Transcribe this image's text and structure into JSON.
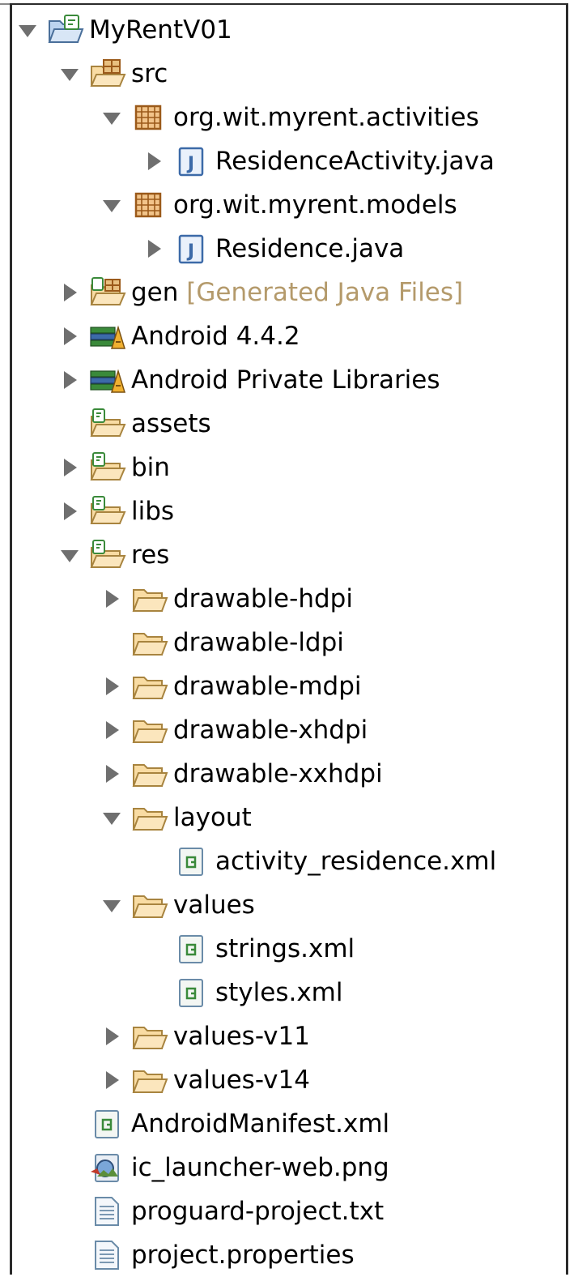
{
  "tree": [
    {
      "level": 0,
      "toggle": "open",
      "icon": "project-folder-icon",
      "label": "MyRentV01"
    },
    {
      "level": 1,
      "toggle": "open",
      "icon": "source-folder-icon",
      "label": "src"
    },
    {
      "level": 2,
      "toggle": "open",
      "icon": "package-icon",
      "label": "org.wit.myrent.activities"
    },
    {
      "level": 3,
      "toggle": "closed",
      "icon": "java-file-icon",
      "label": "ResidenceActivity.java"
    },
    {
      "level": 2,
      "toggle": "open",
      "icon": "package-icon",
      "label": "org.wit.myrent.models"
    },
    {
      "level": 3,
      "toggle": "closed",
      "icon": "java-file-icon",
      "label": "Residence.java"
    },
    {
      "level": 1,
      "toggle": "closed",
      "icon": "generated-folder-icon",
      "label": "gen",
      "extra": "[Generated Java Files]"
    },
    {
      "level": 1,
      "toggle": "closed",
      "icon": "library-icon",
      "label": "Android 4.4.2"
    },
    {
      "level": 1,
      "toggle": "closed",
      "icon": "library-icon",
      "label": "Android Private Libraries"
    },
    {
      "level": 1,
      "toggle": "none",
      "icon": "resource-folder-icon",
      "label": "assets"
    },
    {
      "level": 1,
      "toggle": "closed",
      "icon": "resource-folder-icon",
      "label": "bin"
    },
    {
      "level": 1,
      "toggle": "closed",
      "icon": "resource-folder-icon",
      "label": "libs"
    },
    {
      "level": 1,
      "toggle": "open",
      "icon": "resource-folder-icon",
      "label": "res"
    },
    {
      "level": 2,
      "toggle": "closed",
      "icon": "folder-icon",
      "label": "drawable-hdpi"
    },
    {
      "level": 2,
      "toggle": "none",
      "icon": "folder-icon",
      "label": "drawable-ldpi"
    },
    {
      "level": 2,
      "toggle": "closed",
      "icon": "folder-icon",
      "label": "drawable-mdpi"
    },
    {
      "level": 2,
      "toggle": "closed",
      "icon": "folder-icon",
      "label": "drawable-xhdpi"
    },
    {
      "level": 2,
      "toggle": "closed",
      "icon": "folder-icon",
      "label": "drawable-xxhdpi"
    },
    {
      "level": 2,
      "toggle": "open",
      "icon": "folder-icon",
      "label": "layout"
    },
    {
      "level": 3,
      "toggle": "none",
      "icon": "xml-file-icon",
      "label": "activity_residence.xml"
    },
    {
      "level": 2,
      "toggle": "open",
      "icon": "folder-icon",
      "label": "values"
    },
    {
      "level": 3,
      "toggle": "none",
      "icon": "xml-file-icon",
      "label": "strings.xml"
    },
    {
      "level": 3,
      "toggle": "none",
      "icon": "xml-file-icon",
      "label": "styles.xml"
    },
    {
      "level": 2,
      "toggle": "closed",
      "icon": "folder-icon",
      "label": "values-v11"
    },
    {
      "level": 2,
      "toggle": "closed",
      "icon": "folder-icon",
      "label": "values-v14"
    },
    {
      "level": 1,
      "toggle": "none",
      "icon": "xml-file-icon",
      "label": "AndroidManifest.xml"
    },
    {
      "level": 1,
      "toggle": "none",
      "icon": "image-file-icon",
      "label": "ic_launcher-web.png"
    },
    {
      "level": 1,
      "toggle": "none",
      "icon": "text-file-icon",
      "label": "proguard-project.txt"
    },
    {
      "level": 1,
      "toggle": "none",
      "icon": "text-file-icon",
      "label": "project.properties"
    }
  ],
  "colors": {
    "folder_fill": "#f9dca3",
    "folder_stroke": "#a8843f",
    "package_brown": "#9b5a1a",
    "java_blue": "#3c6aa8",
    "xml_green": "#3a8a3a",
    "gen_text": "#b49a6b"
  }
}
